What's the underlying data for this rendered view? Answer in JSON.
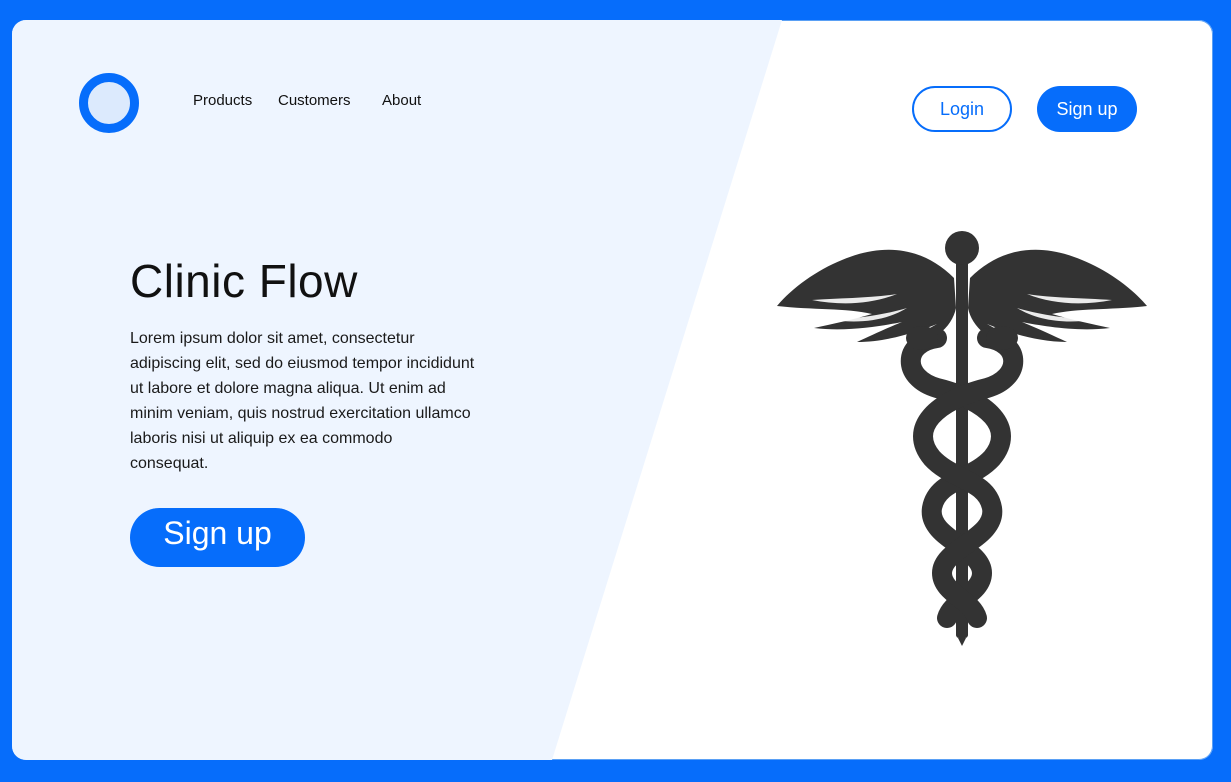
{
  "header": {
    "nav": [
      "Products",
      "Customers",
      "About"
    ],
    "login_label": "Login",
    "signup_label": "Sign up"
  },
  "hero": {
    "title": "Clinic Flow",
    "text": "Lorem ipsum dolor sit amet, consectetur adipiscing elit, sed do eiusmod tempor incididunt ut labore et dolore magna aliqua. Ut enim ad minim veniam, quis nostrud exercitation ullamco laboris nisi ut aliquip ex ea commodo consequat.",
    "cta_label": "Sign up"
  },
  "icons": {
    "logo": "circle-logo-icon",
    "illustration": "caduceus-icon"
  },
  "colors": {
    "frame": "#066dfb",
    "accent": "#066dfb",
    "panel_left": "#eef5ff",
    "panel_right": "#ffffff",
    "illustration": "#333333"
  }
}
